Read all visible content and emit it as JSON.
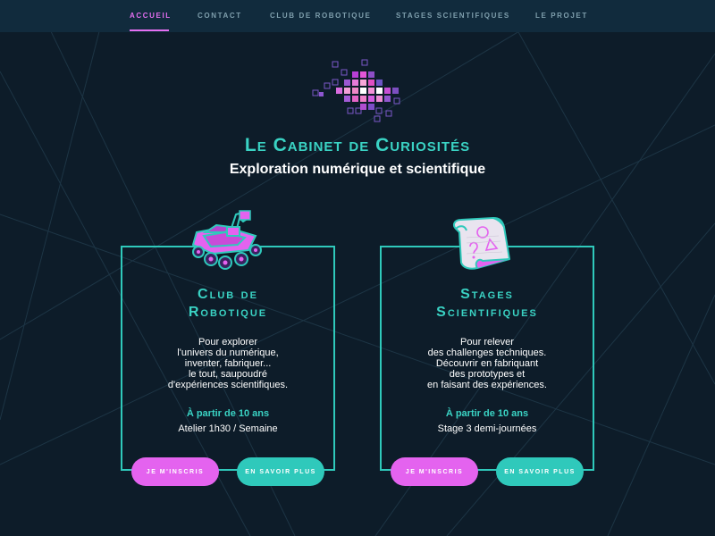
{
  "nav": {
    "items": [
      {
        "label": "Accueil",
        "active": true
      },
      {
        "label": "Contact",
        "active": false
      },
      {
        "label": "Club de robotique",
        "active": false
      },
      {
        "label": "Stages scientifiques",
        "active": false
      },
      {
        "label": "Le projet",
        "active": false
      }
    ]
  },
  "hero": {
    "title": "Le Cabinet de Curiosités",
    "subtitle": "Exploration numérique et scientifique"
  },
  "cards": [
    {
      "icon": "robot-rover-icon",
      "title_lines": [
        "Club de",
        "Robotique"
      ],
      "description_lines": [
        "Pour explorer",
        "l'univers du numérique,",
        "inventer, fabriquer...",
        "le tout, saupoudré",
        "d'expériences scientifiques."
      ],
      "age": "À partir de 10 ans",
      "info": "Atelier 1h30 / Semaine",
      "primary_button": "Je m'inscris",
      "secondary_button": "En savoir plus"
    },
    {
      "icon": "scroll-icon",
      "title_lines": [
        "Stages",
        "Scientifiques"
      ],
      "description_lines": [
        "Pour relever",
        "des challenges techniques.",
        "Découvrir en fabriquant",
        "des prototypes et",
        "en faisant des expériences."
      ],
      "age": "À partir de 10 ans",
      "info": "Stage 3 demi-journées",
      "primary_button": "Je m'inscris",
      "secondary_button": "En savoir plus"
    }
  ],
  "colors": {
    "background": "#0d1c29",
    "nav_background": "#112b3d",
    "accent_teal": "#2fc9bb",
    "accent_pink": "#e463ef"
  }
}
